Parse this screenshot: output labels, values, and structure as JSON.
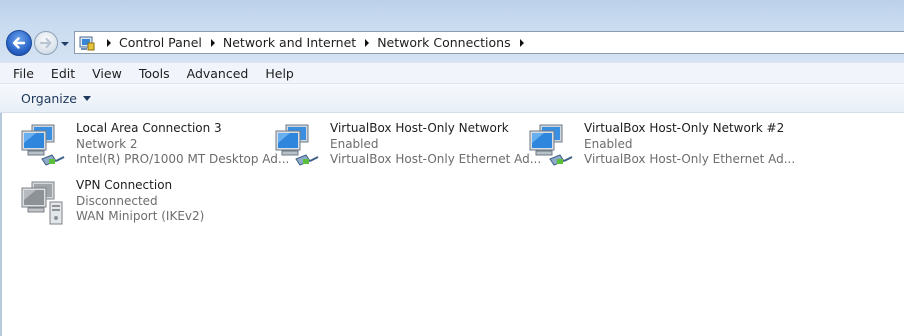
{
  "address_bar": {
    "breadcrumbs": [
      "Control Panel",
      "Network and Internet",
      "Network Connections"
    ]
  },
  "menu": [
    "File",
    "Edit",
    "View",
    "Tools",
    "Advanced",
    "Help"
  ],
  "toolbar": {
    "organize_label": "Organize"
  },
  "connections": [
    {
      "name": "Local Area Connection 3",
      "status": "Network  2",
      "adapter": "Intel(R) PRO/1000 MT Desktop Ad...",
      "icon": "ethernet-connection-icon"
    },
    {
      "name": "VirtualBox Host-Only Network",
      "status": "Enabled",
      "adapter": "VirtualBox Host-Only Ethernet Ad...",
      "icon": "ethernet-connection-icon"
    },
    {
      "name": "VirtualBox Host-Only Network #2",
      "status": "Enabled",
      "adapter": "VirtualBox Host-Only Ethernet Ad...",
      "icon": "ethernet-connection-icon"
    },
    {
      "name": "VPN Connection",
      "status": "Disconnected",
      "adapter": "WAN Miniport (IKEv2)",
      "icon": "vpn-connection-icon"
    }
  ]
}
